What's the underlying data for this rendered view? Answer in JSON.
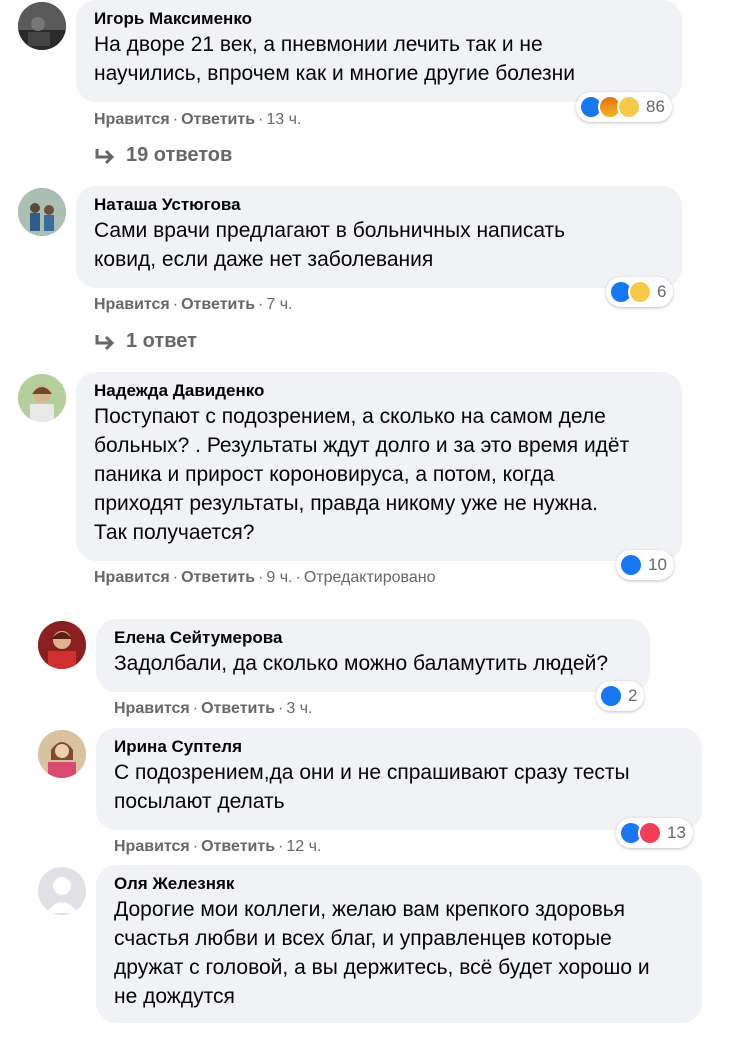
{
  "comments": [
    {
      "author": "Игорь Максименко",
      "lines": [
        "На дворе 21 век, а пневмонии лечить так и не",
        "научились, впрочем как и многие другие болезни"
      ],
      "like": "Нравится",
      "reply": "Ответить",
      "time": "13 ч.",
      "reactions": [
        "like-icon",
        "angry-icon",
        "wow-icon"
      ],
      "reaction_count": "86",
      "replies_label": "19 ответов"
    },
    {
      "author": "Наташа Устюгова",
      "lines": [
        "Сами врачи предлагают в больничных написать",
        "ковид, если даже нет заболевания"
      ],
      "like": "Нравится",
      "reply": "Ответить",
      "time": "7 ч.",
      "reactions": [
        "like-icon",
        "wow-icon"
      ],
      "reaction_count": "6",
      "replies_label": "1 ответ"
    },
    {
      "author": "Надежда Давиденко",
      "lines": [
        "Поступают с подозрением, а сколько на самом деле",
        "больных? . Результаты ждут долго и за это время идёт",
        "паника и прирост короновируса, а потом, когда",
        "приходят результаты, правда никому уже не нужна.",
        "Так получается?"
      ],
      "like": "Нравится",
      "reply": "Ответить",
      "time": "9 ч.",
      "edited": "Отредактировано",
      "reactions": [
        "like-icon"
      ],
      "reaction_count": "10"
    },
    {
      "author": "Елена Сейтумерова",
      "lines": [
        "Задолбали, да сколько можно баламутить людей?"
      ],
      "like": "Нравится",
      "reply": "Ответить",
      "time": "3 ч.",
      "reactions": [
        "like-icon"
      ],
      "reaction_count": "2"
    },
    {
      "author": "Ирина Суптеля",
      "lines": [
        "С подозрением,да они и не спрашивают сразу тесты",
        "посылают делать"
      ],
      "like": "Нравится",
      "reply": "Ответить",
      "time": "12 ч.",
      "reactions": [
        "like-icon",
        "love-icon"
      ],
      "reaction_count": "13"
    },
    {
      "author": "Оля Железняк",
      "lines": [
        "Дорогие мои коллеги, желаю вам крепкого здоровья",
        "счастья любви и всех благ, и управленцев которые",
        "дружат с головой, а вы держитесь, всё будет хорошо и",
        "не дождутся"
      ]
    }
  ],
  "separator": "·",
  "colors": {
    "bubble": "#f0f2f5",
    "meta": "#65676b",
    "like": "#1877f2",
    "love": "#f33e58",
    "wow": "#f7c946"
  }
}
